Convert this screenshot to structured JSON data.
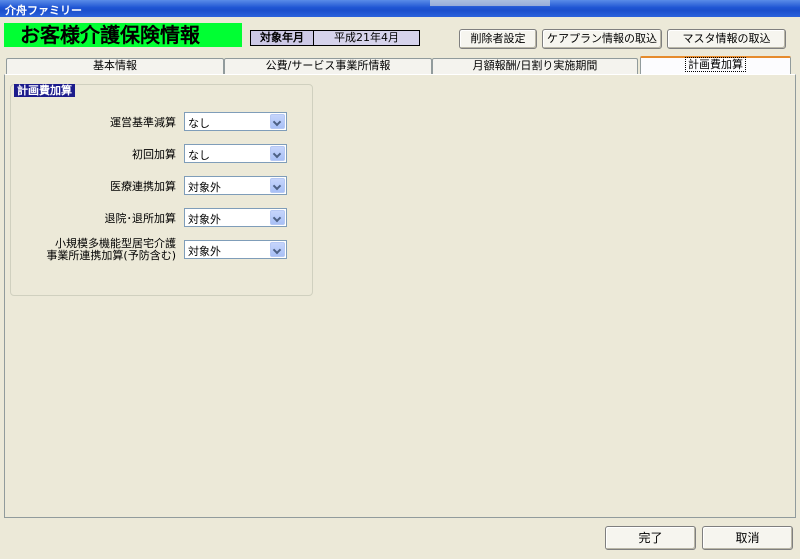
{
  "window": {
    "title": "介舟ファミリー"
  },
  "header": {
    "title": "お客様介護保険情報",
    "target_month_label": "対象年月",
    "target_month_value": "平成21年4月",
    "buttons": {
      "delete_setting": "削除者設定",
      "careplan_import": "ケアプラン情報の取込",
      "master_import": "マスタ情報の取込"
    }
  },
  "tabs": [
    {
      "label": "基本情報",
      "active": false
    },
    {
      "label": "公費/サービス事業所情報",
      "active": false
    },
    {
      "label": "月額報酬/日割り実施期間",
      "active": false
    },
    {
      "label": "計画費加算",
      "active": true
    }
  ],
  "group": {
    "title": "計画費加算",
    "rows": [
      {
        "label": "運営基準減算",
        "value": "なし"
      },
      {
        "label": "初回加算",
        "value": "なし"
      },
      {
        "label": "医療連携加算",
        "value": "対象外"
      },
      {
        "label": "退院･退所加算",
        "value": "対象外"
      },
      {
        "label_line1": "小規模多機能型居宅介護",
        "label_line2": "事業所連携加算(予防含む)",
        "value": "対象外"
      }
    ]
  },
  "footer": {
    "complete": "完了",
    "cancel": "取消"
  },
  "colors": {
    "title_bg": "#00ff33",
    "titlebar": "#1f55d3",
    "group_label_bg": "#1c1c8c",
    "active_tab_accent": "#e68b2c"
  }
}
